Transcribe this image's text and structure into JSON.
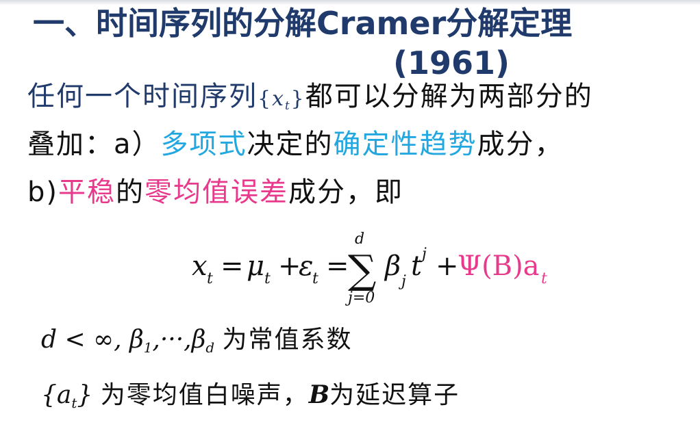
{
  "title": {
    "line1": "一、时间序列的分解Cramer分解定理",
    "line2": "(1961)"
  },
  "paragraph": {
    "p1": "任何一个时间序列",
    "series_open": "{",
    "series_var": "x",
    "series_sub": "t",
    "series_close": "}",
    "p2": "都可以分解为两部分的",
    "p3": "叠加：",
    "a_label": "a）",
    "poly": "多项式",
    "p4": "决定的",
    "trend": "确定性趋势",
    "p5": "成分，",
    "b_label": "b)",
    "stationary": "平稳",
    "p6": "的",
    "zero_mean_error": "零均值误差",
    "p7": "成分，即"
  },
  "formula": {
    "lhs": "x",
    "lhs_sub": "t",
    "eq1": "=",
    "mu": "μ",
    "mu_sub": "t",
    "plus1": "+",
    "eps": "ε",
    "eps_sub": "t",
    "eq2": "=",
    "sum": "∑",
    "sum_upper": "d",
    "sum_lower": "j=0",
    "beta": "β",
    "beta_sub": "j",
    "t": "t",
    "t_sup": "j",
    "plus2": "+",
    "psi_term": "Ψ(B)a",
    "psi_sub": "t"
  },
  "notes": {
    "n1_math": "d < ∞, β",
    "n1_sub1": "1",
    "n1_mid": ",···,β",
    "n1_subd": "d",
    "n1_text": "为常值系数",
    "n2_open": "{a",
    "n2_sub": "t",
    "n2_close": "}",
    "n2_text": "为零均值白噪声，",
    "n2_B": "B",
    "n2_text2": "为延迟算子"
  },
  "colors": {
    "title": "#1f3a6b",
    "cyan": "#22a7e0",
    "pink": "#e83a8c",
    "text": "#111111"
  }
}
